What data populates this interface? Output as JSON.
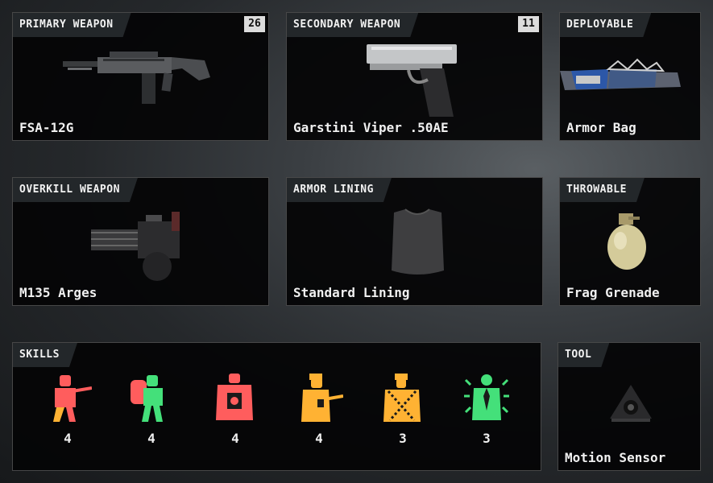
{
  "cards": {
    "primary": {
      "label": "PRIMARY WEAPON",
      "count": "26",
      "name": "FSA-12G"
    },
    "secondary": {
      "label": "SECONDARY WEAPON",
      "count": "11",
      "name": "Garstini Viper .50AE"
    },
    "deployable": {
      "label": "DEPLOYABLE",
      "name": "Armor Bag"
    },
    "overkill": {
      "label": "OVERKILL WEAPON",
      "name": "M135 Arges"
    },
    "armor": {
      "label": "ARMOR LINING",
      "name": "Standard Lining"
    },
    "throwable": {
      "label": "THROWABLE",
      "name": "Frag Grenade"
    },
    "tool": {
      "label": "TOOL",
      "name": "Motion Sensor"
    }
  },
  "skills": {
    "label": "SKILLS",
    "items": [
      {
        "icon": "gunner-icon",
        "color": "#ff5d5d",
        "value": "4"
      },
      {
        "icon": "backpack-icon",
        "color": "#44e07a",
        "value": "4"
      },
      {
        "icon": "vest-icon",
        "color": "#ff5d5d",
        "value": "4"
      },
      {
        "icon": "rifleman-icon",
        "color": "#ffb233",
        "value": "4"
      },
      {
        "icon": "ammo-belt-icon",
        "color": "#ffb233",
        "value": "3"
      },
      {
        "icon": "suit-icon",
        "color": "#44e07a",
        "value": "3"
      }
    ]
  }
}
